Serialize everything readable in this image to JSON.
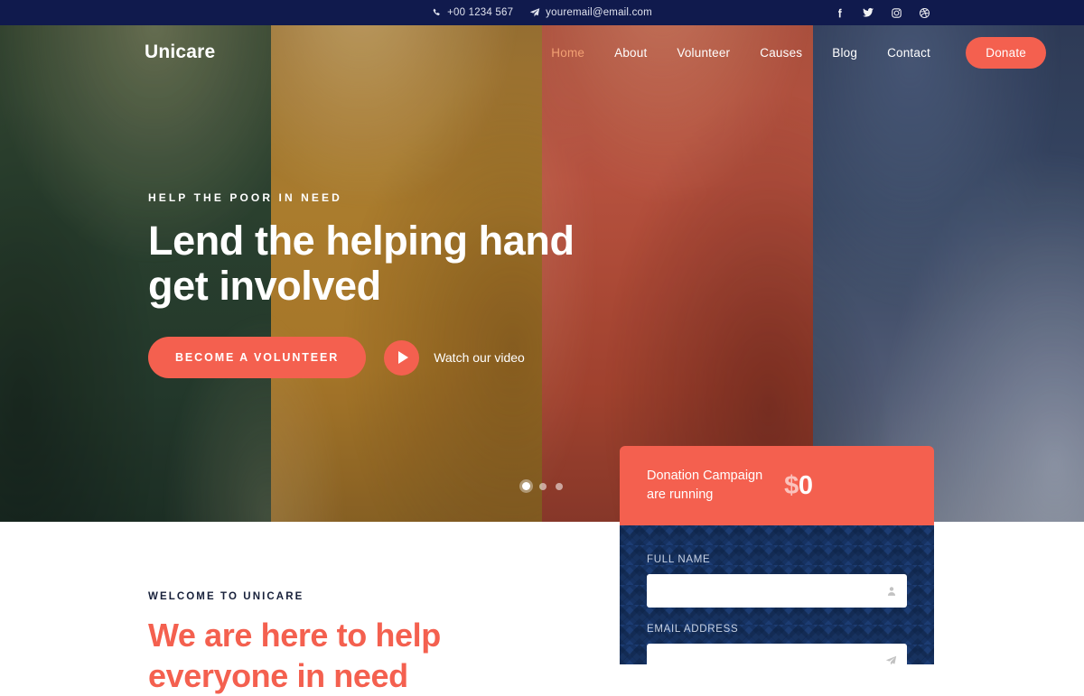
{
  "topbar": {
    "phone": "+00 1234 567",
    "email": "youremail@email.com",
    "social": [
      {
        "name": "facebook-icon",
        "label": "Facebook"
      },
      {
        "name": "twitter-icon",
        "label": "Twitter"
      },
      {
        "name": "instagram-icon",
        "label": "Instagram"
      },
      {
        "name": "dribbble-icon",
        "label": "Dribbble"
      }
    ]
  },
  "header": {
    "logo": "Unicare",
    "nav": [
      {
        "label": "Home",
        "active": true
      },
      {
        "label": "About",
        "active": false
      },
      {
        "label": "Volunteer",
        "active": false
      },
      {
        "label": "Causes",
        "active": false
      },
      {
        "label": "Blog",
        "active": false
      },
      {
        "label": "Contact",
        "active": false
      }
    ],
    "donate_label": "Donate"
  },
  "hero": {
    "eyebrow": "HELP THE POOR IN NEED",
    "title_line1": "Lend the helping hand",
    "title_line2": "get involved",
    "cta_primary": "BECOME A VOLUNTEER",
    "video_label": "Watch our video",
    "slides": 3,
    "active_slide": 1,
    "band_colors": [
      "#2d4430",
      "#b0802c",
      "#b04c37",
      "#4a5670"
    ]
  },
  "donation_card": {
    "text_line1": "Donation Campaign",
    "text_line2": "are running",
    "currency": "$",
    "amount": "0"
  },
  "donation_form": {
    "fields": [
      {
        "label": "FULL NAME",
        "value": "",
        "placeholder": "",
        "icon": "user-icon"
      },
      {
        "label": "EMAIL ADDRESS",
        "value": "",
        "placeholder": "",
        "icon": "send-icon"
      }
    ]
  },
  "welcome": {
    "eyebrow": "WELCOME TO UNICARE",
    "title_line1": "We are here to help",
    "title_line2": "everyone in need"
  },
  "colors": {
    "accent": "#f4604f",
    "topbar_bg": "#101a4d",
    "form_bg": "#1c3c73",
    "nav_active": "#f2a073"
  }
}
